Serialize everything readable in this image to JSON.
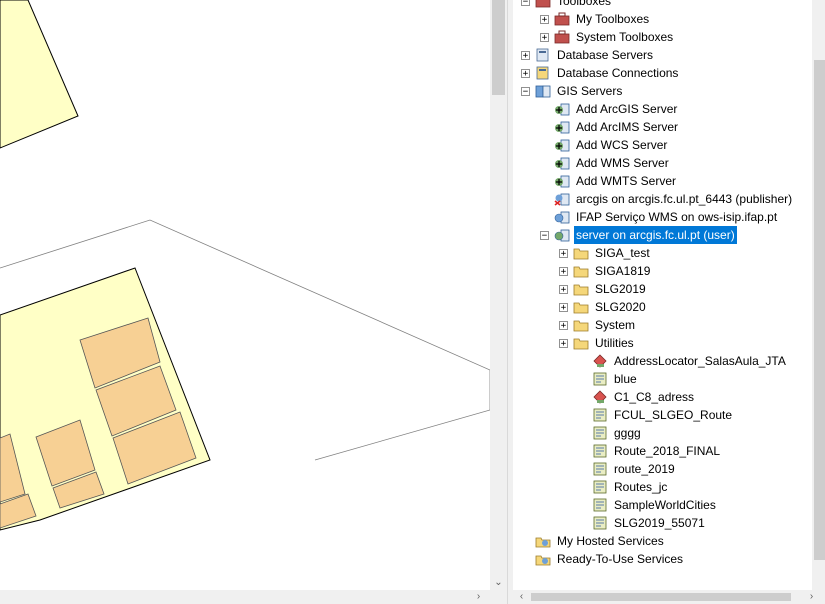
{
  "catalog": {
    "rows": [
      {
        "label": "Toolboxes",
        "exp": "−",
        "icon": "toolbox-icon",
        "indent": 0
      },
      {
        "label": "My Toolboxes",
        "exp": "+",
        "icon": "toolbox-icon",
        "indent": 1
      },
      {
        "label": "System Toolboxes",
        "exp": "+",
        "icon": "toolbox-icon",
        "indent": 1
      },
      {
        "label": "Database Servers",
        "exp": "+",
        "icon": "database-server-icon",
        "indent": 0
      },
      {
        "label": "Database Connections",
        "exp": "+",
        "icon": "database-connection-icon",
        "indent": 0
      },
      {
        "label": "GIS Servers",
        "exp": "−",
        "icon": "gis-server-icon",
        "indent": 0
      },
      {
        "label": "Add ArcGIS Server",
        "exp": "",
        "icon": "add-server-icon",
        "indent": 1
      },
      {
        "label": "Add ArcIMS Server",
        "exp": "",
        "icon": "add-server-icon",
        "indent": 1
      },
      {
        "label": "Add WCS Server",
        "exp": "",
        "icon": "add-server-icon",
        "indent": 1
      },
      {
        "label": "Add WMS Server",
        "exp": "",
        "icon": "add-server-icon",
        "indent": 1
      },
      {
        "label": "Add WMTS Server",
        "exp": "",
        "icon": "add-server-icon",
        "indent": 1
      },
      {
        "label": "arcgis on arcgis.fc.ul.pt_6443 (publisher)",
        "exp": "",
        "icon": "server-error-icon",
        "indent": 1
      },
      {
        "label": "IFAP Serviço WMS on ows-isip.ifap.pt",
        "exp": "",
        "icon": "wms-server-icon",
        "indent": 1
      },
      {
        "label": "server on arcgis.fc.ul.pt (user)",
        "exp": "−",
        "icon": "server-connection-icon",
        "indent": 1,
        "selected": true
      },
      {
        "label": "SIGA_test",
        "exp": "+",
        "icon": "folder-icon",
        "indent": 2
      },
      {
        "label": "SIGA1819",
        "exp": "+",
        "icon": "folder-icon",
        "indent": 2
      },
      {
        "label": "SLG2019",
        "exp": "+",
        "icon": "folder-icon",
        "indent": 2
      },
      {
        "label": "SLG2020",
        "exp": "+",
        "icon": "folder-icon",
        "indent": 2
      },
      {
        "label": "System",
        "exp": "+",
        "icon": "folder-icon",
        "indent": 2
      },
      {
        "label": "Utilities",
        "exp": "+",
        "icon": "folder-icon",
        "indent": 2
      },
      {
        "label": "AddressLocator_SalasAula_JTA",
        "exp": "",
        "icon": "locator-service-icon",
        "indent": 3
      },
      {
        "label": "blue",
        "exp": "",
        "icon": "map-service-icon",
        "indent": 3
      },
      {
        "label": "C1_C8_adress",
        "exp": "",
        "icon": "locator-service-icon",
        "indent": 3
      },
      {
        "label": "FCUL_SLGEO_Route",
        "exp": "",
        "icon": "map-service-icon",
        "indent": 3
      },
      {
        "label": "gggg",
        "exp": "",
        "icon": "map-service-icon",
        "indent": 3
      },
      {
        "label": "Route_2018_FINAL",
        "exp": "",
        "icon": "map-service-icon",
        "indent": 3
      },
      {
        "label": "route_2019",
        "exp": "",
        "icon": "map-service-icon",
        "indent": 3
      },
      {
        "label": "Routes_jc",
        "exp": "",
        "icon": "map-service-icon",
        "indent": 3
      },
      {
        "label": "SampleWorldCities",
        "exp": "",
        "icon": "map-service-icon",
        "indent": 3
      },
      {
        "label": "SLG2019_55071",
        "exp": "",
        "icon": "map-service-icon",
        "indent": 3
      },
      {
        "label": "My Hosted Services",
        "exp": "",
        "icon": "hosted-services-icon",
        "indent": 0
      },
      {
        "label": "Ready-To-Use Services",
        "exp": "",
        "icon": "hosted-services-icon",
        "indent": 0
      }
    ]
  },
  "colors": {
    "parcel_fill": "#ffffc6",
    "building_fill": "#f7d094",
    "selection": "#0078d7",
    "folder": "#f5d77a"
  }
}
